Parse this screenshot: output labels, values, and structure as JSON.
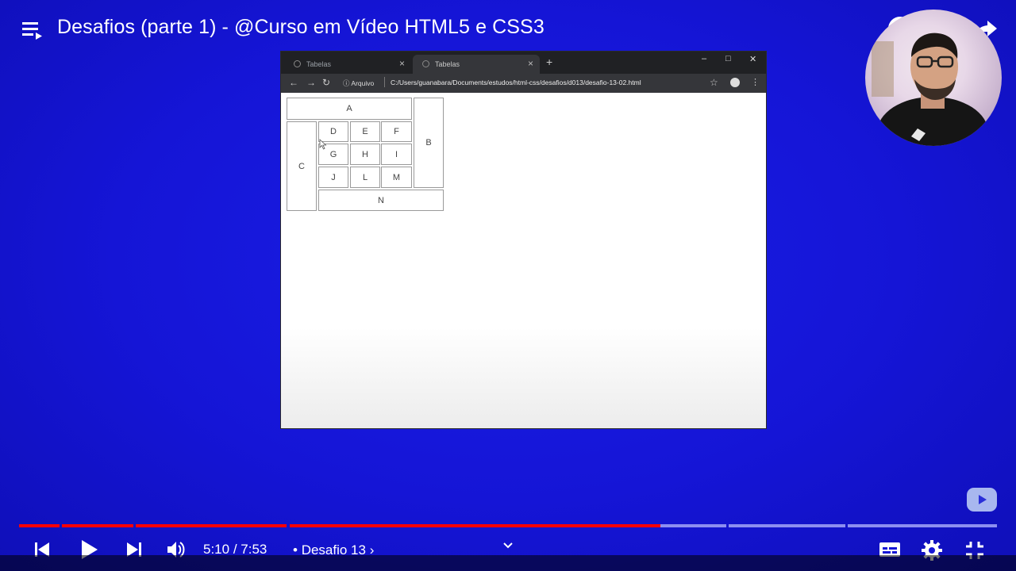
{
  "title": "Desafios (parte 1) - @Curso em Vídeo HTML5 e CSS3",
  "icons": {
    "playlist": "playlist-icon",
    "info": "info-icon",
    "watch_later": "clock-icon",
    "share": "share-icon"
  },
  "browser": {
    "tabs": [
      {
        "label": "Tabelas"
      },
      {
        "label": "Tabelas"
      }
    ],
    "new_tab": "+",
    "address_prefix": "Arquivo",
    "url": "C:/Users/guanabara/Documents/estudos/html-css/desafios/d013/desafio-13-02.html"
  },
  "table_cells": {
    "a": "A",
    "b": "B",
    "c": "C",
    "d": "D",
    "e": "E",
    "f": "F",
    "g": "G",
    "h": "H",
    "i": "I",
    "j": "J",
    "l": "L",
    "m": "M",
    "n": "N"
  },
  "player": {
    "progress_played": 0.657,
    "current_time": "5:10",
    "separator": " / ",
    "duration": "7:53",
    "chapter_bullet": "•",
    "chapter": "Desafio 13",
    "chapter_arrow": "›",
    "colors": {
      "played": "#ff0000",
      "buffered": "#8d8ff0",
      "background": "#1515d6"
    }
  }
}
